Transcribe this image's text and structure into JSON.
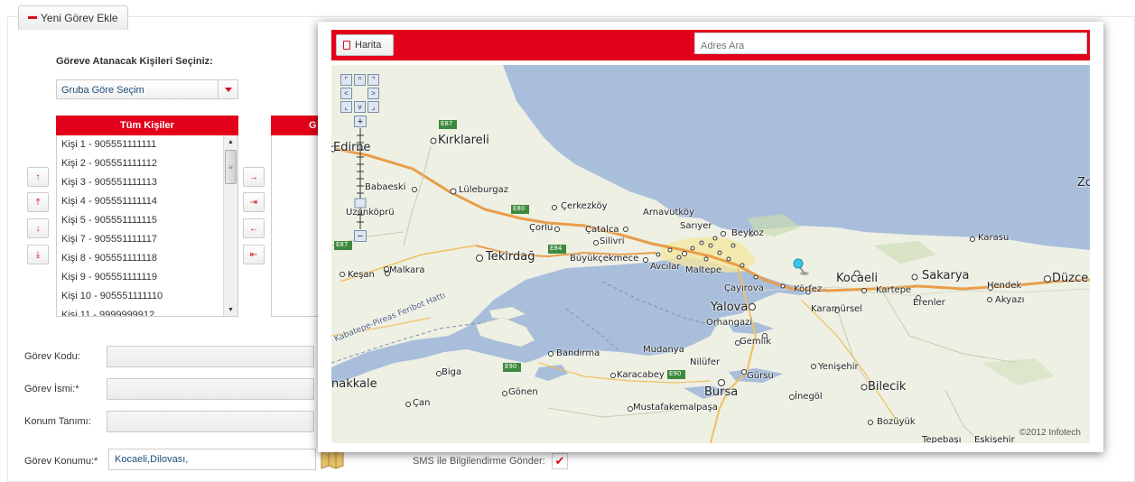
{
  "tab": {
    "label": "Yeni Görev Ekle"
  },
  "assign": {
    "label": "Göreve Atanacak Kişileri Seçiniz:",
    "group_select": "Gruba Göre Seçim",
    "all_people_header": "Tüm Kişiler",
    "selected_header_partial": "G",
    "people": [
      "Kişi 1 - 905551111111",
      "Kişi 2 - 905551111112",
      "Kişi 3 - 905551111113",
      "Kişi 4 - 905551111114",
      "Kişi 5 - 905551111115",
      "Kişi 7 - 905551111117",
      "Kişi 8 - 905551111118",
      "Kişi 9 - 905551111119",
      "Kişi 10 - 905551111110",
      "Kişi 11 - 9999999912"
    ]
  },
  "sort_buttons": {
    "up": "↑",
    "top": "⤒",
    "down": "↓",
    "bottom": "⤓"
  },
  "move_buttons": {
    "right": "→",
    "all_right": "⇥",
    "left": "←",
    "all_left": "⇤"
  },
  "form": {
    "code_label": "Görev Kodu:",
    "name_label": "Görev İsmi:*",
    "location_def_label": "Konum Tanımı:",
    "location_label": "Görev Konumu:*",
    "location_value": "Kocaeli,Dilovası,",
    "sms_label": "SMS ile Bilgilendirme Gönder:",
    "sms_checked": true
  },
  "map_popup": {
    "map_button": "Harita",
    "search_placeholder": "Adres Ara",
    "copyright": "©2012 Infotech",
    "pan": {
      "nw": "⌜",
      "n": "^",
      "ne": "⌝",
      "w": "<",
      "e": ">",
      "sw": "⌞",
      "s": "v",
      "se": "⌟"
    },
    "zoom_in": "+",
    "zoom_out": "−",
    "places": {
      "edirne": "Edirne",
      "kirklareli": "Kırklareli",
      "babaeski": "Babaeski",
      "luleburgaz": "Lüleburgaz",
      "uzunkopru": "Uzunköprü",
      "corlu": "Çorlu",
      "cerkezkoy": "Çerkezköy",
      "catalca": "Çatalca",
      "silivri": "Silivri",
      "arnavutkoy": "Arnavutköy",
      "sariyer": "Sarıyer",
      "beykoz": "Beykoz",
      "tekirdag": "Tekirdağ",
      "buyukcekmece": "Büyükçekmece",
      "avcilar": "Avcılar",
      "maltepe": "Maltepe",
      "kesan": "Keşan",
      "malkara": "Malkara",
      "cayirova": "Çayırova",
      "korfez": "Körfez",
      "kocaeli": "Kocaeli",
      "kartepe": "Kartepe",
      "sakarya": "Sakarya",
      "erenler": "Erenler",
      "akyazi": "Akyazı",
      "hendek": "Hendek",
      "duzce": "Düzce",
      "karasu": "Karasu",
      "karamursel": "Karamürsel",
      "yalova": "Yalova",
      "orhangazi": "Orhangazi",
      "gemlik": "Gemlik",
      "mudanya": "Mudanya",
      "bandirma": "Bandırma",
      "biga": "Biga",
      "karacabey": "Karacabey",
      "nilufer": "Nilüfer",
      "gursu": "Gürsu",
      "bursa": "Bursa",
      "yenisehir": "Yenişehir",
      "inegol": "İnegöl",
      "bilecik": "Bilecik",
      "canakkale": "nakkale",
      "gonen": "Gönen",
      "can": "Çan",
      "mustafakemalpasa": "Mustafakemalpaşa",
      "bozuyuk": "Bozüyük",
      "tepebasi": "Tepebaşı",
      "eskisehir": "Eskişehir",
      "zo": "Zo",
      "ferry": "Kabatepe-Pireas Feribot Hattı"
    },
    "roads": {
      "e87a": "E87",
      "e80": "E80",
      "e84": "E84",
      "e87b": "E87",
      "e90a": "E90",
      "e90b": "E90"
    }
  },
  "colors": {
    "accent": "#e2001a",
    "sea": "#a8bedb",
    "land": "#eef0e4"
  }
}
